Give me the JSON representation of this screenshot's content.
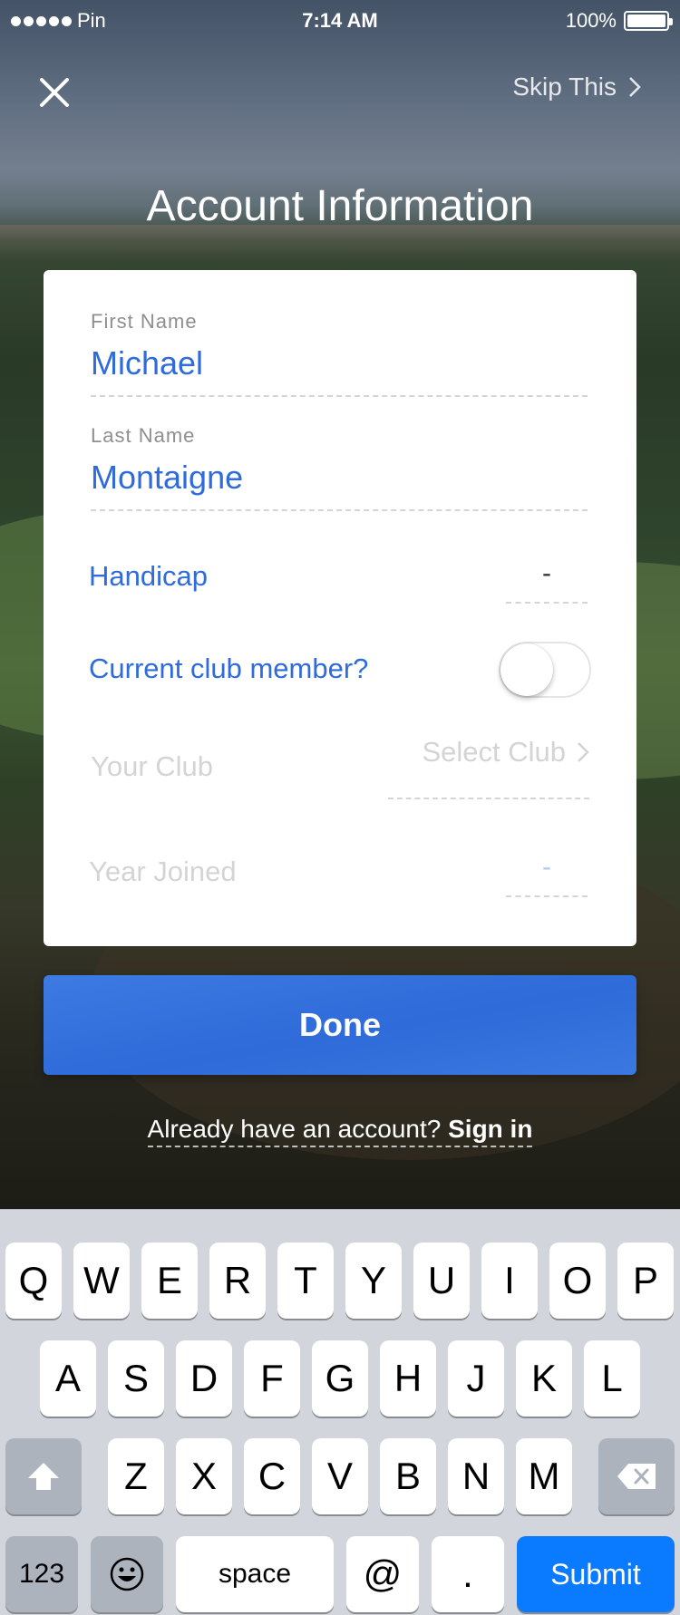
{
  "status_bar": {
    "carrier": "Pin",
    "time": "7:14 AM",
    "battery": "100%"
  },
  "header": {
    "skip_label": "Skip This",
    "title": "Account Information"
  },
  "form": {
    "first_name": {
      "label": "First Name",
      "value": "Michael"
    },
    "last_name": {
      "label": "Last Name",
      "value": "Montaigne"
    },
    "handicap": {
      "label": "Handicap",
      "value": "-"
    },
    "club_member": {
      "label": "Current club member?",
      "on": false
    },
    "your_club": {
      "label": "Your Club",
      "value": "Select Club"
    },
    "year_joined": {
      "label": "Year Joined",
      "value": "-"
    }
  },
  "done_label": "Done",
  "signin": {
    "prompt": "Already have an account?",
    "link": "Sign in"
  },
  "keyboard": {
    "row1": [
      "Q",
      "W",
      "E",
      "R",
      "T",
      "Y",
      "U",
      "I",
      "O",
      "P"
    ],
    "row2": [
      "A",
      "S",
      "D",
      "F",
      "G",
      "H",
      "J",
      "K",
      "L"
    ],
    "row3": [
      "Z",
      "X",
      "C",
      "V",
      "B",
      "N",
      "M"
    ],
    "numbers": "123",
    "space": "space",
    "at": "@",
    "dot": ".",
    "submit": "Submit"
  },
  "colors": {
    "accent": "#2f6bd9",
    "submit_key": "#0a7aff",
    "keyboard_bg": "#d2d5db"
  }
}
